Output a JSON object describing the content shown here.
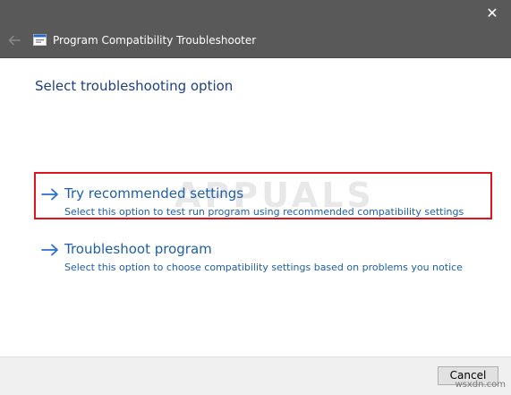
{
  "window": {
    "title": "Program Compatibility Troubleshooter",
    "close_label": "✕"
  },
  "main": {
    "heading": "Select troubleshooting option",
    "options": [
      {
        "title": "Try recommended settings",
        "description": "Select this option to test run program using recommended compatibility settings"
      },
      {
        "title": "Troubleshoot program",
        "description": "Select this option to choose compatibility settings based on problems you notice"
      }
    ]
  },
  "footer": {
    "cancel_label": "Cancel"
  },
  "watermark": {
    "text": "APPUALS"
  },
  "site_mark": "wsxdn.com",
  "colors": {
    "titlebar": "#595959",
    "heading": "#1f3f84",
    "link": "#1f5fa8",
    "highlight": "#e0141e"
  }
}
